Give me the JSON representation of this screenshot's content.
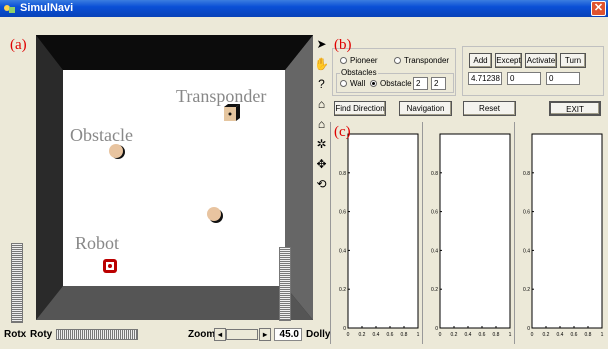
{
  "window": {
    "title": "SimulNavi",
    "close_glyph": "✕"
  },
  "panel_labels": {
    "a": "(a)",
    "b": "(b)",
    "c": "(c)"
  },
  "scene": {
    "transponder": "Transponder",
    "obstacle": "Obstacle",
    "robot": "Robot"
  },
  "bottom": {
    "rotx": "Rotx",
    "roty": "Roty",
    "zoom": "Zoom",
    "zoom_value": "45.0",
    "dolly": "Dolly"
  },
  "toolbar": {
    "icons": [
      "arrow-pointer-icon",
      "hand-icon",
      "question-icon",
      "home-icon",
      "home-up-icon",
      "fan-icon",
      "move-cross-icon",
      "rotate-icon"
    ],
    "glyphs": [
      "➤",
      "✋",
      "?",
      "⌂",
      "⌂",
      "✲",
      "✥",
      "⟲"
    ]
  },
  "controls": {
    "pioneer": "Pioneer",
    "transponder": "Transponder",
    "obstacles_group": "Obstacles",
    "wall": "Wall",
    "obstacle": "Obstacle",
    "obstacle_val1": "2",
    "obstacle_val2": "2",
    "add": "Add",
    "except": "Except",
    "activate": "Activate",
    "turn": "Turn",
    "angle": "4.71238",
    "field2": "0",
    "field3": "0",
    "find_direction": "Find Direction",
    "navigation": "Navigation",
    "reset": "Reset",
    "exit": "EXIT"
  },
  "chart_data": [
    {
      "type": "line",
      "x": [],
      "y": [],
      "xlim": [
        0,
        1
      ],
      "ylim": [
        0,
        1
      ],
      "yticks": [
        "0",
        "0.2",
        "0.4",
        "0.6",
        "0.8"
      ],
      "xticks": [
        "0",
        "0.2",
        "0.4",
        "0.6",
        "0.8",
        "1"
      ]
    },
    {
      "type": "line",
      "x": [],
      "y": [],
      "xlim": [
        0,
        1
      ],
      "ylim": [
        0,
        1
      ],
      "yticks": [
        "0",
        "0.2",
        "0.4",
        "0.6",
        "0.8"
      ],
      "xticks": [
        "0",
        "0.2",
        "0.4",
        "0.6",
        "0.8",
        "1"
      ]
    },
    {
      "type": "line",
      "x": [],
      "y": [],
      "xlim": [
        0,
        1
      ],
      "ylim": [
        0,
        1
      ],
      "yticks": [
        "0",
        "0.2",
        "0.4",
        "0.6",
        "0.8"
      ],
      "xticks": [
        "0",
        "0.2",
        "0.4",
        "0.6",
        "0.8",
        "1"
      ]
    }
  ]
}
